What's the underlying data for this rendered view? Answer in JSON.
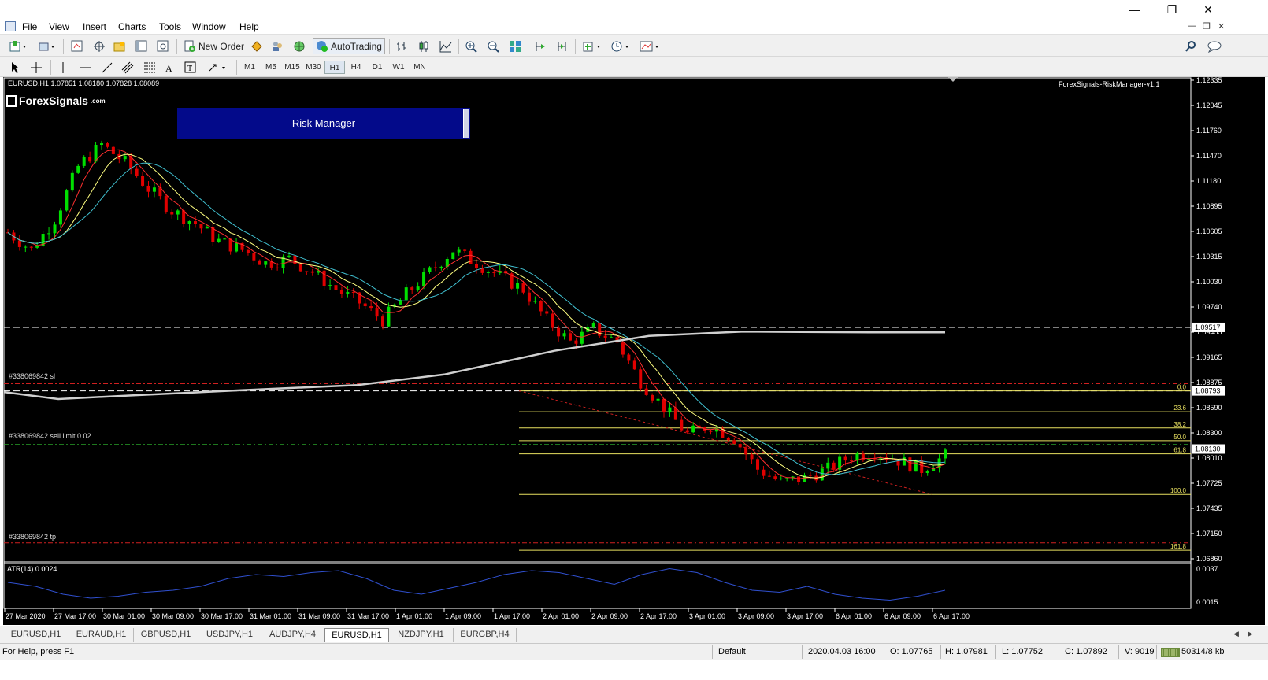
{
  "menu": {
    "items": [
      "File",
      "View",
      "Insert",
      "Charts",
      "Tools",
      "Window",
      "Help"
    ]
  },
  "toolbar": {
    "new_order": "New Order",
    "autotrading": "AutoTrading",
    "timeframes": [
      "M1",
      "M5",
      "M15",
      "M30",
      "H1",
      "H4",
      "D1",
      "W1",
      "MN"
    ],
    "active_timeframe": "H1"
  },
  "chart": {
    "symbol_header": "EURUSD,H1  1.07851 1.08180 1.07828 1.08089",
    "ea_label": "ForexSignals-RiskManager-v1.1",
    "logo_text": "ForexSignals",
    "logo_suffix": ".com",
    "risk_manager_label": "Risk Manager",
    "price_axis": [
      "1.12335",
      "1.12045",
      "1.11760",
      "1.11470",
      "1.11180",
      "1.10895",
      "1.10605",
      "1.10315",
      "1.10030",
      "1.09740",
      "1.09455",
      "1.09165",
      "1.08875",
      "1.08590",
      "1.08300",
      "1.08010",
      "1.07725",
      "1.07435",
      "1.07150",
      "1.06860"
    ],
    "price_tags": [
      {
        "value": "1.09517",
        "price": 1.09517
      },
      {
        "value": "1.08793",
        "price": 1.08793
      },
      {
        "value": "1.08130",
        "price": 1.0813
      }
    ],
    "order_lines": [
      {
        "label": "#338069842 sl",
        "price": 1.08875
      },
      {
        "label": "#338069842 sell limit 0.02",
        "price": 1.0818
      },
      {
        "label": "#338069842 tp",
        "price": 1.0706
      }
    ],
    "fibo_levels": [
      {
        "label": "0.0",
        "price": 1.08793
      },
      {
        "label": "23.6",
        "price": 1.08555
      },
      {
        "label": "38.2",
        "price": 1.0837
      },
      {
        "label": "50.0",
        "price": 1.08225
      },
      {
        "label": "61.8",
        "price": 1.08075
      },
      {
        "label": "100.0",
        "price": 1.07612
      },
      {
        "label": "161.8",
        "price": 1.06975
      }
    ],
    "time_axis": [
      "27 Mar 2020",
      "27 Mar 17:00",
      "30 Mar 01:00",
      "30 Mar 09:00",
      "30 Mar 17:00",
      "31 Mar 01:00",
      "31 Mar 09:00",
      "31 Mar 17:00",
      "1 Apr 01:00",
      "1 Apr 09:00",
      "1 Apr 17:00",
      "2 Apr 01:00",
      "2 Apr 09:00",
      "2 Apr 17:00",
      "3 Apr 01:00",
      "3 Apr 09:00",
      "3 Apr 17:00",
      "6 Apr 01:00",
      "6 Apr 09:00",
      "6 Apr 17:00"
    ],
    "atr_label": "ATR(14) 0.0024",
    "atr_axis": [
      "0.0037",
      "0.0015"
    ],
    "colors": {
      "bull": "#00e000",
      "bear": "#e00000",
      "fibo": "#e8e060",
      "order": "#d02020",
      "ma_slow": "#d0d0d0",
      "ma_fast": "#ff3030",
      "ma_mid": "#ffff80",
      "ma_cyan": "#40c0d0",
      "atr": "#3050d0"
    }
  },
  "chart_data": {
    "type": "candlestick",
    "title": "EURUSD,H1",
    "ylim": [
      1.0686,
      1.12335
    ],
    "close_path": [
      1.106,
      1.104,
      1.1075,
      1.1135,
      1.116,
      1.114,
      1.111,
      1.1085,
      1.107,
      1.105,
      1.104,
      1.1025,
      1.103,
      1.1015,
      1.0995,
      1.098,
      1.096,
      1.099,
      1.1015,
      1.104,
      1.1025,
      1.101,
      1.0995,
      1.096,
      1.0935,
      1.095,
      1.0935,
      1.089,
      1.086,
      1.083,
      1.084,
      1.0825,
      1.079,
      1.0775,
      1.078,
      1.079,
      1.0805,
      1.081,
      1.08,
      1.079,
      1.0805
    ]
  },
  "tabs": {
    "items": [
      "EURUSD,H1",
      "EURAUD,H1",
      "GBPUSD,H1",
      "USDJPY,H1",
      "AUDJPY,H4",
      "EURUSD,H1",
      "NZDJPY,H1",
      "EURGBP,H4"
    ],
    "active_index": 5
  },
  "status": {
    "help": "For Help, press F1",
    "profile": "Default",
    "datetime": "2020.04.03 16:00",
    "open": "O: 1.07765",
    "high": "H: 1.07981",
    "low": "L: 1.07752",
    "close": "C: 1.07892",
    "volume": "V: 9019",
    "traffic": "50314/8 kb"
  }
}
